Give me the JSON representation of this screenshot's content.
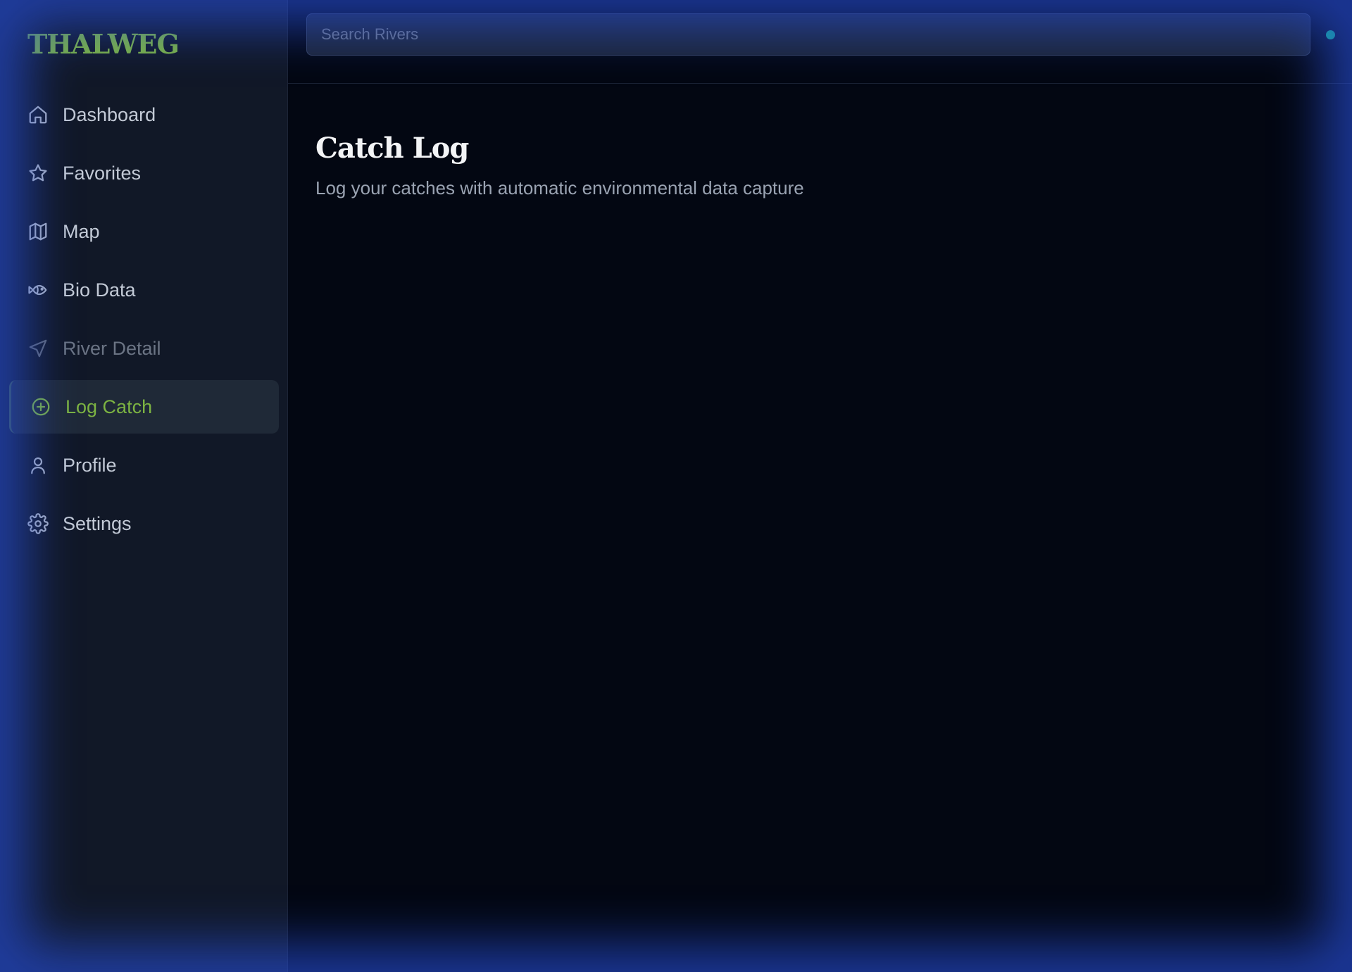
{
  "app": {
    "logo": "THALWEG"
  },
  "sidebar": {
    "items": [
      {
        "label": "Dashboard",
        "icon": "home-icon",
        "state": "normal"
      },
      {
        "label": "Favorites",
        "icon": "star-icon",
        "state": "normal"
      },
      {
        "label": "Map",
        "icon": "map-icon",
        "state": "normal"
      },
      {
        "label": "Bio Data",
        "icon": "fish-icon",
        "state": "normal"
      },
      {
        "label": "River Detail",
        "icon": "navigation-icon",
        "state": "disabled"
      },
      {
        "label": "Log Catch",
        "icon": "plus-circle-icon",
        "state": "active"
      },
      {
        "label": "Profile",
        "icon": "user-icon",
        "state": "normal"
      },
      {
        "label": "Settings",
        "icon": "gear-icon",
        "state": "normal"
      }
    ]
  },
  "header": {
    "search_placeholder": "Search Rivers",
    "status_color": "#10b981"
  },
  "main": {
    "title": "Catch Log",
    "subtitle": "Log your catches with automatic environmental data capture"
  },
  "colors": {
    "accent": "#7cb342",
    "sidebar_bg": "#111827",
    "main_bg": "#030712",
    "frame_glow": "#1f3fae"
  }
}
